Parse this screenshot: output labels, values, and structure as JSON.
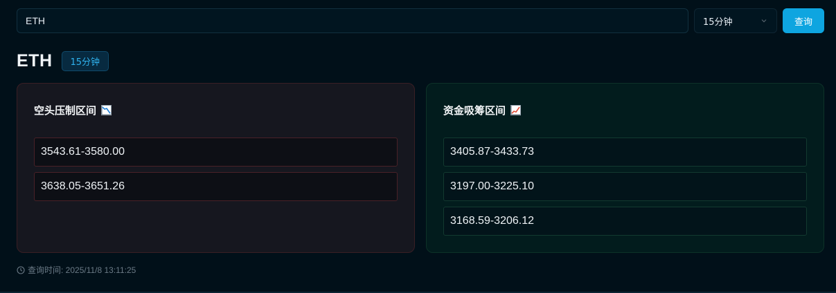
{
  "search": {
    "symbol_value": "ETH",
    "interval_selected": "15分钟",
    "query_label": "查询"
  },
  "header": {
    "title": "ETH",
    "interval_badge": "15分钟"
  },
  "bear_card": {
    "title": "空头压制区间",
    "icon": "chart-decreasing-icon",
    "ranges": [
      "3543.61-3580.00",
      "3638.05-3651.26"
    ]
  },
  "bull_card": {
    "title": "资金吸筹区间",
    "icon": "chart-increasing-icon",
    "ranges": [
      "3405.87-3433.73",
      "3197.00-3225.10",
      "3168.59-3206.12"
    ]
  },
  "footer": {
    "query_time": "查询时间: 2025/11/8 13:11:25"
  },
  "colors": {
    "background": "#011019",
    "accent": "#0ea5e0",
    "bear_border": "#3a1f25",
    "bull_border": "#0d3228"
  }
}
